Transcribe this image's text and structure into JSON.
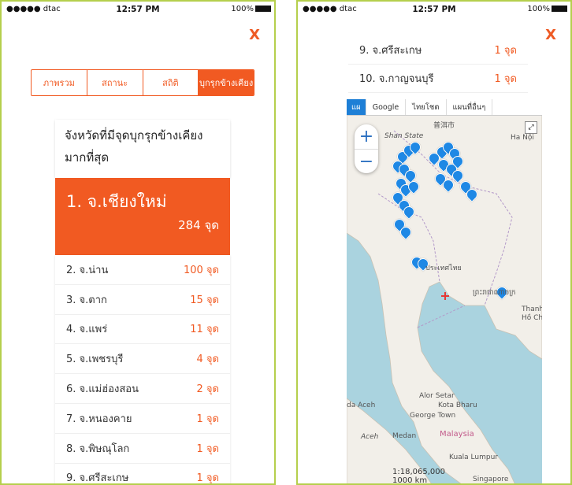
{
  "status": {
    "carrier": "●●●●● dtac",
    "time": "12:57 PM",
    "battery": "100%"
  },
  "close_label": "X",
  "tabs": [
    {
      "label": "ภาพรวม"
    },
    {
      "label": "สถานะ"
    },
    {
      "label": "สถิติ"
    },
    {
      "label": "บุกรุกข้างเคียง"
    }
  ],
  "card_title": "จังหวัดที่มีจุดบุกรุกข้างเคียง มากที่สุด",
  "top": {
    "name": "1. จ.เชียงใหม่",
    "count": "284 จุด"
  },
  "ranks": [
    {
      "name": "2. จ.น่าน",
      "count": "100 จุด"
    },
    {
      "name": "3. จ.ตาก",
      "count": "15 จุด"
    },
    {
      "name": "4. จ.แพร่",
      "count": "11 จุด"
    },
    {
      "name": "5. จ.เพชรบุรี",
      "count": "4 จุด"
    },
    {
      "name": "6. จ.แม่ฮ่องสอน",
      "count": "2 จุด"
    },
    {
      "name": "7. จ.หนองคาย",
      "count": "1 จุด"
    },
    {
      "name": "8. จ.พิษณุโลก",
      "count": "1 จุด"
    },
    {
      "name": "9. จ.ศรีสะเกษ",
      "count": "1 จุด"
    }
  ],
  "right_ranks": [
    {
      "name": "9. จ.ศรีสะเกษ",
      "count": "1 จุด"
    },
    {
      "name": "10. จ.กาญจนบุรี",
      "count": "1 จุด"
    }
  ],
  "map": {
    "toolbar": [
      "แผ",
      "Google",
      "ไทยโชต",
      "แผนที่อื่นๆ"
    ],
    "labels": {
      "shan": "Shan State",
      "hanoi": "Ha Nội",
      "chinese": "普洱市",
      "thai": "ประเทศไทย",
      "cambodia": "ព្រះរាជាណាចក្រ",
      "thanh": "Thanh",
      "hochi": "Hồ Chí M",
      "alor": "Alor Setar",
      "kota": "Kota Bharu",
      "george": "George Town",
      "aceh": "da Aceh",
      "aceh2": "Aceh",
      "medan": "Medan",
      "malaysia": "Malaysia",
      "kuala": "Kuala Lumpur",
      "singapore": "Singapore"
    },
    "scale_ratio": "1:18,065,000",
    "scale_km": "1000 km",
    "pin_color": "#1e88e5"
  }
}
